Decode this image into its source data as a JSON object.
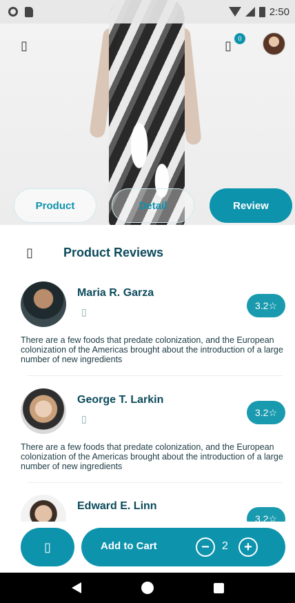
{
  "status_bar": {
    "time": "2:50"
  },
  "header": {
    "menu_icon": "▯",
    "cart_icon": "▯",
    "cart_count": "0"
  },
  "tabs": [
    {
      "label": "Product",
      "active": false
    },
    {
      "label": "Detail",
      "active": false
    },
    {
      "label": "Review",
      "active": true
    }
  ],
  "reviews_section": {
    "icon": "▯",
    "title": "Product Reviews"
  },
  "reviews": [
    {
      "name": "Maria R. Garza",
      "stars_icon": "▯",
      "rating": "3.2☆",
      "text": "There are a few foods that predate colonization, and the European colonization of the Americas brought about the introduction of a large number of new ingredients"
    },
    {
      "name": "George T. Larkin",
      "stars_icon": "▯",
      "rating": "3.2☆",
      "text": "There are a few foods that predate colonization, and the European colonization of the Americas brought about the introduction of a large number of new ingredients"
    },
    {
      "name": "Edward E. Linn",
      "stars_icon": "▯",
      "rating": "3.2☆",
      "text": ""
    }
  ],
  "bottom_bar": {
    "favorite_icon": "▯",
    "add_to_cart_label": "Add to Cart",
    "quantity": "2",
    "minus_symbol": "−",
    "plus_symbol": "+"
  },
  "colors": {
    "accent": "#0e93ad",
    "title": "#0b4a5c"
  }
}
